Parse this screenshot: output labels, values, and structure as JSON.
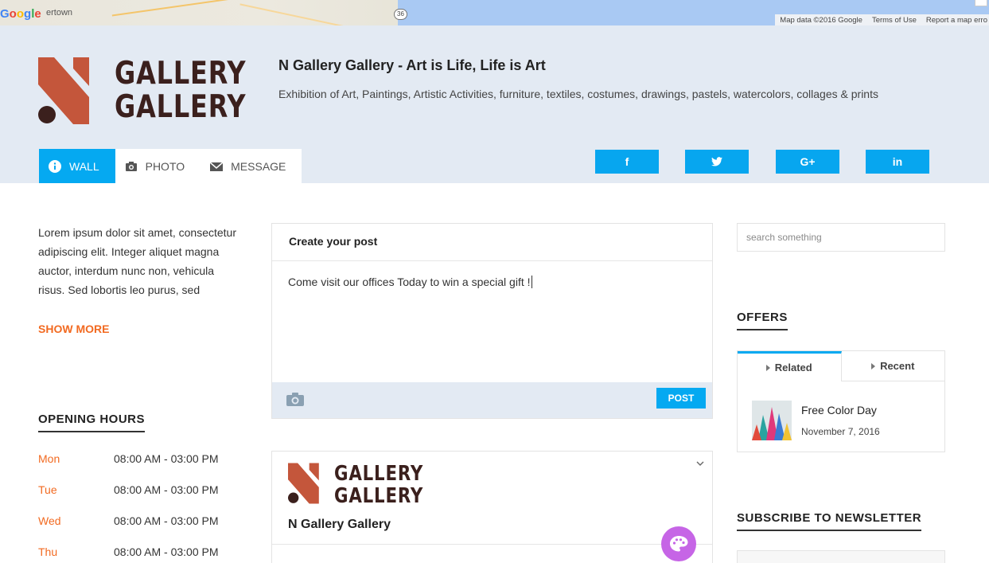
{
  "map": {
    "town": "ertown",
    "route": "36",
    "attribution": [
      "Map data ©2016 Google",
      "Terms of Use",
      "Report a map erro"
    ]
  },
  "header": {
    "logo_line1": "GALLERY",
    "logo_line2": "GALLERY",
    "title": "N Gallery Gallery - Art is Life, Life is Art",
    "description": "Exhibition of Art, Paintings, Artistic Activities, furniture, textiles, costumes, drawings, pastels, watercolors, collages & prints",
    "tabs": [
      {
        "label": "WALL",
        "icon": "info-icon",
        "active": true
      },
      {
        "label": "PHOTO",
        "icon": "camera-icon",
        "active": false
      },
      {
        "label": "MESSAGE",
        "icon": "envelope-icon",
        "active": false
      }
    ],
    "social": [
      {
        "label": "f",
        "icon": "facebook-icon"
      },
      {
        "label": "🐦",
        "icon": "twitter-icon"
      },
      {
        "label": "G+",
        "icon": "google-plus-icon"
      },
      {
        "label": "in",
        "icon": "linkedin-icon"
      }
    ]
  },
  "sidebar": {
    "about": "Lorem ipsum dolor sit amet, consectetur adipiscing elit. Integer aliquet magna auctor, interdum nunc non, vehicula risus. Sed lobortis leo purus, sed",
    "show_more": "SHOW MORE",
    "hours_title": "OPENING HOURS",
    "hours": [
      {
        "day": "Mon",
        "time": "08:00 AM - 03:00 PM"
      },
      {
        "day": "Tue",
        "time": "08:00 AM - 03:00 PM"
      },
      {
        "day": "Wed",
        "time": "08:00 AM - 03:00 PM"
      },
      {
        "day": "Thu",
        "time": "08:00 AM - 03:00 PM"
      }
    ]
  },
  "post": {
    "heading": "Create your post",
    "text": "Come visit our offices Today to win a special gift !",
    "button": "POST"
  },
  "feed": {
    "logo_line1": "GALLERY",
    "logo_line2": "GALLERY",
    "name": "N Gallery Gallery"
  },
  "right": {
    "search_placeholder": "search something",
    "offers_title": "OFFERS",
    "offer_tabs": [
      "Related",
      "Recent"
    ],
    "offer": {
      "title": "Free Color Day",
      "date": "November 7, 2016"
    },
    "newsletter_title": "SUBSCRIBE TO NEWSLETTER"
  },
  "colors": {
    "accent": "#05a9f1",
    "orange": "#f26a21",
    "logo_brown": "#3b201d",
    "logo_rust": "#c4563b",
    "header_bg": "#e3eaf3"
  }
}
